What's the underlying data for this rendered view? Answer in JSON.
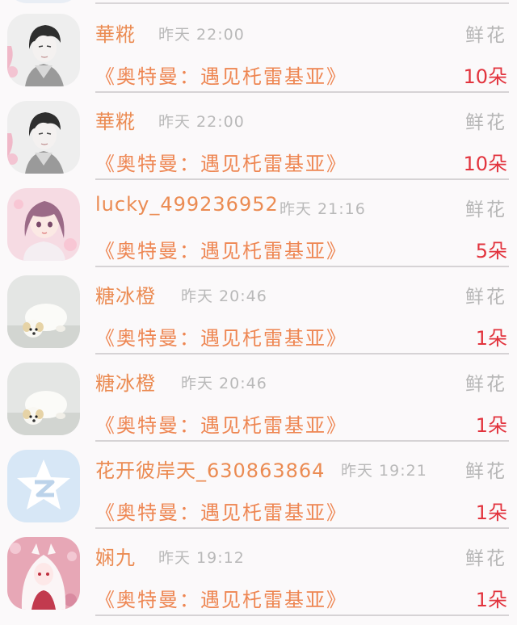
{
  "gift_records": [
    {
      "sender": "華糀",
      "time": "昨天  22:00",
      "gift": "鲜花",
      "book": "《奥特曼：遇见杔雷基亚》",
      "count": "10朵",
      "avatar": "boy-sketch-avatar-icon"
    },
    {
      "sender": "華糀",
      "time": "昨天  22:00",
      "gift": "鲜花",
      "book": "《奥特曼：遇见杔雷基亚》",
      "count": "10朵",
      "avatar": "boy-sketch-avatar-icon"
    },
    {
      "sender": "lucky_499236952",
      "time": "昨天  21:16",
      "gift": "鲜花",
      "book": "《奥特曼：遇见杔雷基亚》",
      "count": "5朵",
      "avatar": "anime-girl-avatar-icon"
    },
    {
      "sender": "糖冰橙",
      "time": "昨天  20:46",
      "gift": "鲜花",
      "book": "《奥特曼：遇见杔雷基亚》",
      "count": "1朵",
      "avatar": "puppy-avatar-icon"
    },
    {
      "sender": "糖冰橙",
      "time": "昨天  20:46",
      "gift": "鲜花",
      "book": "《奥特曼：遇见杔雷基亚》",
      "count": "1朵",
      "avatar": "puppy-avatar-icon"
    },
    {
      "sender": "花开彼岸天_630863864",
      "time": "昨天  19:21",
      "gift": "鲜花",
      "book": "《奥特曼：遇见杔雷基亚》",
      "count": "1朵",
      "avatar": "qzone-star-avatar-icon"
    },
    {
      "sender": "娴九",
      "time": "昨天  19:12",
      "gift": "鲜花",
      "book": "《奥特曼：遇见杔雷基亚》",
      "count": "1朵",
      "avatar": "white-hair-girl-avatar-icon"
    }
  ],
  "colors": {
    "background": "#fbf9fa",
    "sender_name": "#eb8b52",
    "book_title": "#ee8652",
    "count": "#e2333d",
    "muted": "#b9b9b9",
    "divider": "#d6d3d5"
  }
}
